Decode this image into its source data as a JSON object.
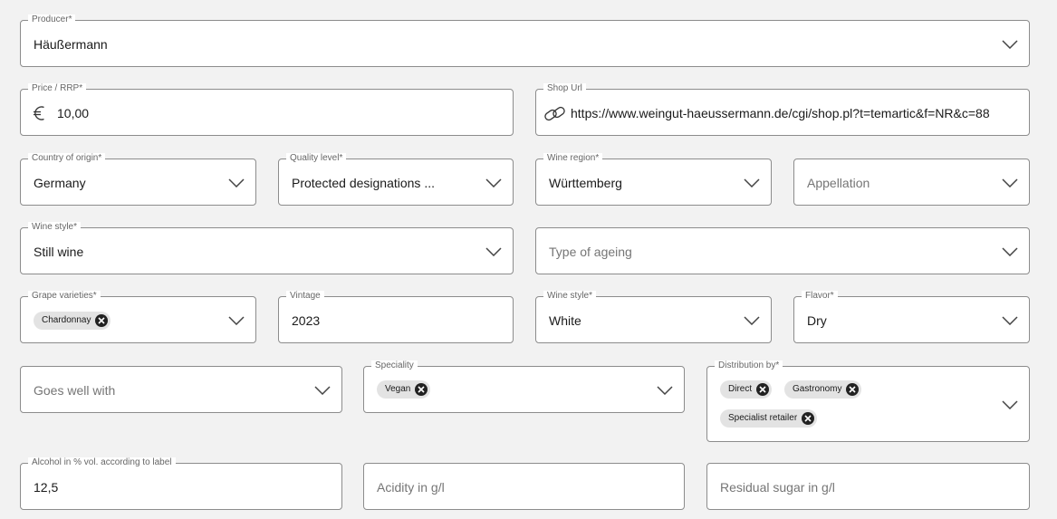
{
  "producer": {
    "label": "Producer*",
    "value": "Häußermann"
  },
  "price": {
    "label": "Price / RRP*",
    "currency_icon": "euro-icon",
    "value": "10,00"
  },
  "shop_url": {
    "label": "Shop Url",
    "link_icon": "link-icon",
    "value": "https://www.weingut-haeussermann.de/cgi/shop.pl?t=temartic&f=NR&c=88"
  },
  "country": {
    "label": "Country of origin*",
    "value": "Germany"
  },
  "quality_level": {
    "label": "Quality level*",
    "value": "Protected designations ..."
  },
  "wine_region": {
    "label": "Wine region*",
    "value": "Württemberg"
  },
  "appellation": {
    "placeholder": "Appellation"
  },
  "wine_style_1": {
    "label": "Wine style*",
    "value": "Still wine"
  },
  "type_of_ageing": {
    "placeholder": "Type of ageing"
  },
  "grape_varieties": {
    "label": "Grape varieties*",
    "chips": [
      "Chardonnay"
    ]
  },
  "vintage": {
    "label": "Vintage",
    "value": "2023"
  },
  "wine_style_2": {
    "label": "Wine style*",
    "value": "White"
  },
  "flavor": {
    "label": "Flavor*",
    "value": "Dry"
  },
  "goes_well_with": {
    "placeholder": "Goes well with"
  },
  "speciality": {
    "label": "Speciality",
    "chips": [
      "Vegan"
    ]
  },
  "distribution_by": {
    "label": "Distribution by*",
    "chips": [
      "Direct",
      "Gastronomy",
      "Specialist retailer"
    ]
  },
  "alcohol": {
    "label": "Alcohol in % vol. according to label",
    "value": "12,5"
  },
  "acidity": {
    "placeholder": "Acidity in g/l"
  },
  "residual_sugar": {
    "placeholder": "Residual sugar in g/l"
  },
  "colors": {
    "border": "#8c8c8c",
    "chip_bg": "#e3e3e3",
    "chip_close": "#222222",
    "page_bg": "#f2f2f2"
  }
}
